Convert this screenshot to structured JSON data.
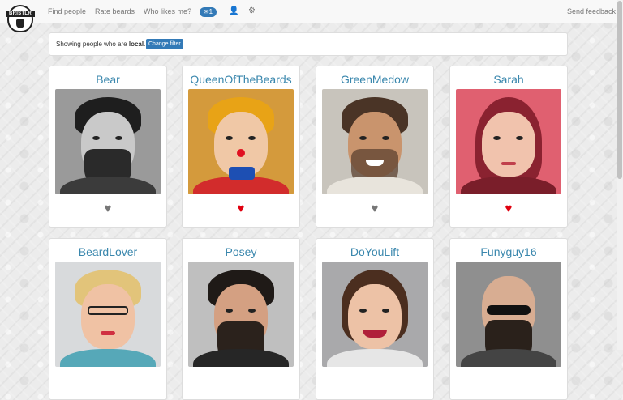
{
  "nav": {
    "logo_text": "BRISTLR",
    "links": [
      "Find people",
      "Rate beards",
      "Who likes me?"
    ],
    "message_count": "1",
    "feedback_label": "Send feedback"
  },
  "filter": {
    "prefix": "Showing people who are ",
    "value": "local",
    "suffix": ".",
    "button_label": "Change filter"
  },
  "people": [
    {
      "name": "Bear",
      "liked": false
    },
    {
      "name": "QueenOfTheBeards",
      "liked": true
    },
    {
      "name": "GreenMedow",
      "liked": false
    },
    {
      "name": "Sarah",
      "liked": true
    },
    {
      "name": "BeardLover",
      "liked": false
    },
    {
      "name": "Posey",
      "liked": false
    },
    {
      "name": "DoYouLift",
      "liked": false
    },
    {
      "name": "Funyguy16",
      "liked": false
    }
  ],
  "colors": {
    "link_blue": "#3a87ad",
    "button_blue": "#337ab7",
    "heart_liked": "#e0000f",
    "heart_unliked": "#777777"
  }
}
